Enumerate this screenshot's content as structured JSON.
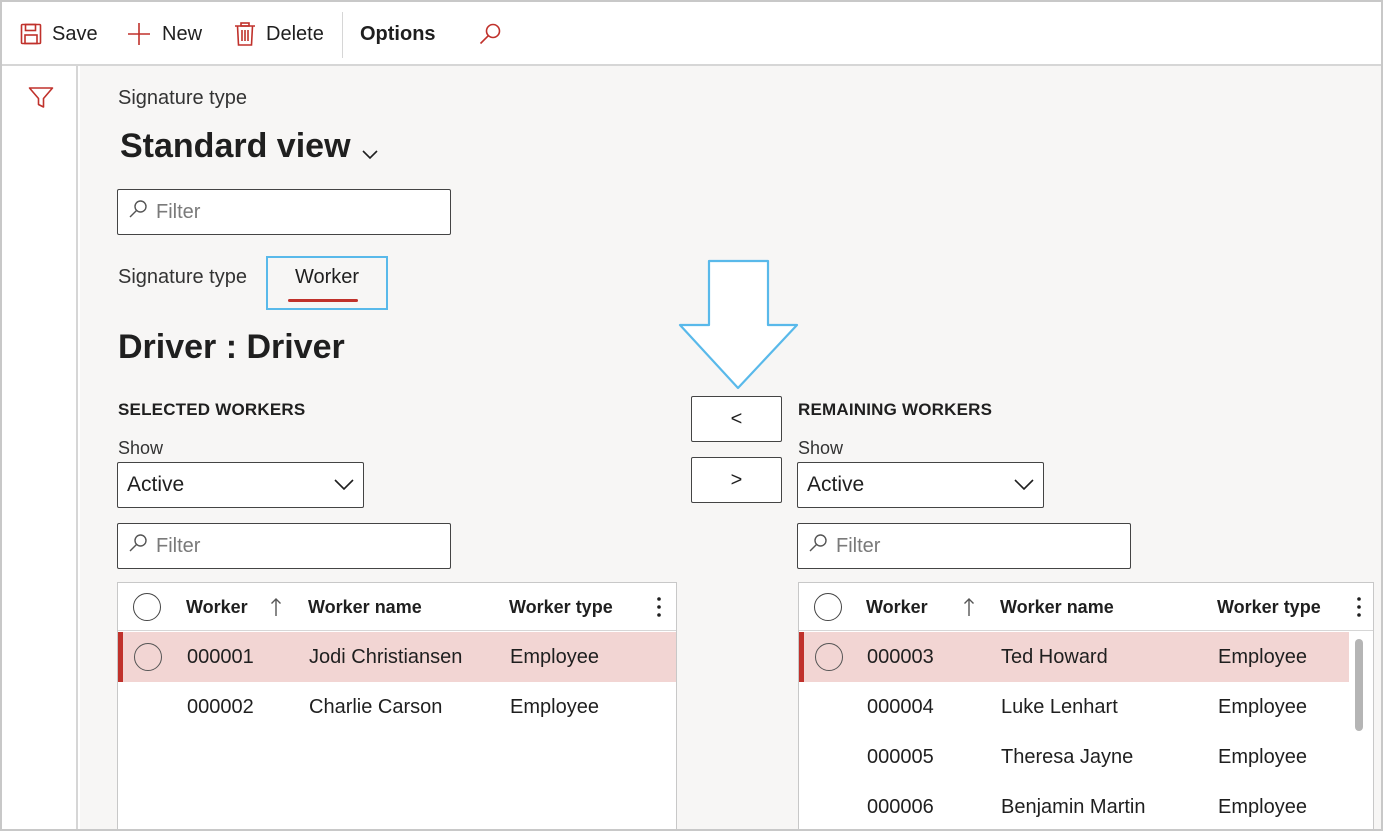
{
  "toolbar": {
    "save_label": "Save",
    "new_label": "New",
    "delete_label": "Delete",
    "options_label": "Options",
    "accent_color": "#c0312b"
  },
  "header": {
    "caption": "Signature type",
    "view_title": "Standard view",
    "filter_placeholder": "Filter"
  },
  "signature": {
    "label": "Signature type",
    "tab_label": "Worker",
    "highlight_color": "#59b9ea"
  },
  "section": {
    "title": "Driver : Driver"
  },
  "selected": {
    "heading": "SELECTED WORKERS",
    "show_label": "Show",
    "show_value": "Active",
    "filter_placeholder": "Filter",
    "columns": [
      "Worker",
      "Worker name",
      "Worker type"
    ],
    "rows": [
      {
        "worker": "000001",
        "name": "Jodi Christiansen",
        "type": "Employee",
        "selected": true
      },
      {
        "worker": "000002",
        "name": "Charlie Carson",
        "type": "Employee",
        "selected": false
      }
    ]
  },
  "move": {
    "left_label": "<",
    "right_label": ">"
  },
  "remaining": {
    "heading": "REMAINING WORKERS",
    "show_label": "Show",
    "show_value": "Active",
    "filter_placeholder": "Filter",
    "columns": [
      "Worker",
      "Worker name",
      "Worker type"
    ],
    "rows": [
      {
        "worker": "000003",
        "name": "Ted Howard",
        "type": "Employee",
        "selected": true
      },
      {
        "worker": "000004",
        "name": "Luke Lenhart",
        "type": "Employee",
        "selected": false
      },
      {
        "worker": "000005",
        "name": "Theresa Jayne",
        "type": "Employee",
        "selected": false
      },
      {
        "worker": "000006",
        "name": "Benjamin Martin",
        "type": "Employee",
        "selected": false
      }
    ]
  }
}
